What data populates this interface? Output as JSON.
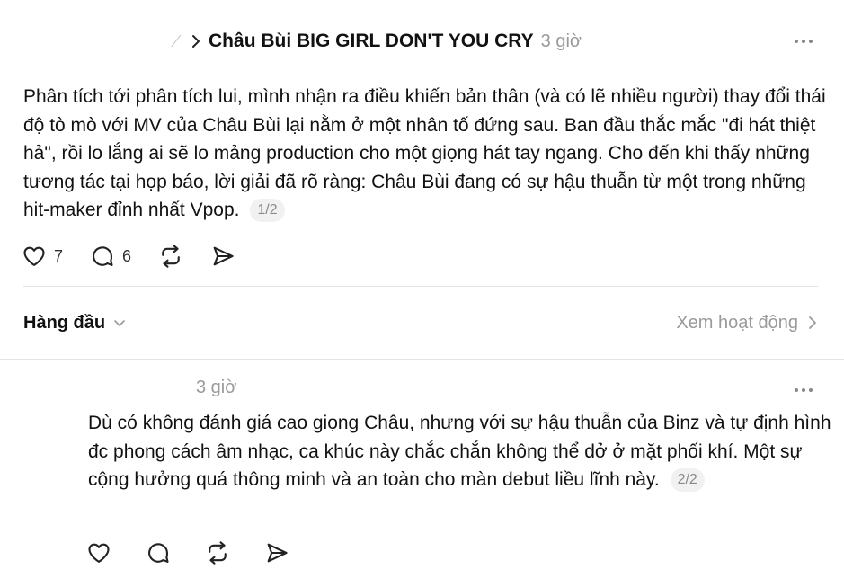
{
  "post": {
    "author_line": "Châu Bùi BIG GIRL DON'T YOU CRY",
    "time": "3 giờ",
    "text": "Phân tích tới phân tích lui, mình nhận ra điều khiến bản thân (và có lẽ nhiều người) thay đổi thái độ tò mò với MV của Châu Bùi lại nằm ở một nhân tố đứng sau. Ban đầu thắc mắc \"đi hát thiệt hả\", rồi lo lắng ai sẽ lo mảng production cho một giọng hát tay ngang. Cho đến khi thấy những tương tác tại họp báo, lời giải đã rõ ràng: Châu Bùi đang có sự hậu thuẫn từ một trong những hit-maker đỉnh nhất Vpop.",
    "page": "1/2",
    "likes": "7",
    "replies": "6"
  },
  "sort": {
    "label": "Hàng đầu",
    "activity_label": "Xem hoạt động"
  },
  "reply": {
    "time": "3 giờ",
    "text": "Dù có không đánh giá cao giọng Châu, nhưng với sự hậu thuẫn của Binz và tự định hình đc phong cách âm nhạc, ca khúc này chắc chắn không thể dở ở mặt phối khí. Một sự cộng hưởng quá thông minh và an toàn cho màn debut liều lĩnh này.",
    "page": "2/2"
  },
  "icons": {
    "like": "heart-icon",
    "reply": "comment-icon",
    "repost": "repost-icon",
    "share": "send-icon",
    "more": "more-icon",
    "chevron_right": "chevron-right-icon",
    "chevron_down": "chevron-down-icon"
  }
}
